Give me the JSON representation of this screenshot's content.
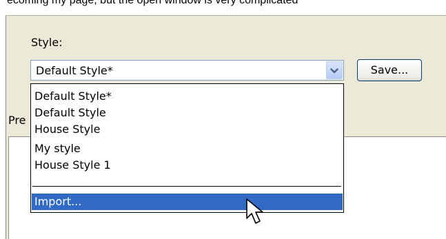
{
  "header": {
    "text_fragment": "ecoming my page, but the open window is very complicated"
  },
  "style_section": {
    "label": "Style:",
    "selected_value": "Default Style*",
    "save_button_label": "Save..."
  },
  "dropdown": {
    "options": [
      "Default Style*",
      "Default Style",
      "House Style",
      "My style",
      "House Style 1"
    ],
    "import_label": "Import...",
    "highlight_color": "#316ac5"
  },
  "preview": {
    "label_fragment": "Pre"
  },
  "icons": {
    "combo_arrow": "chevron-down-icon",
    "cursor": "mouse-pointer-icon"
  },
  "colors": {
    "dialog_bg": "#ece9d8",
    "border_blue": "#7f9db9",
    "button_border": "#003c74"
  }
}
